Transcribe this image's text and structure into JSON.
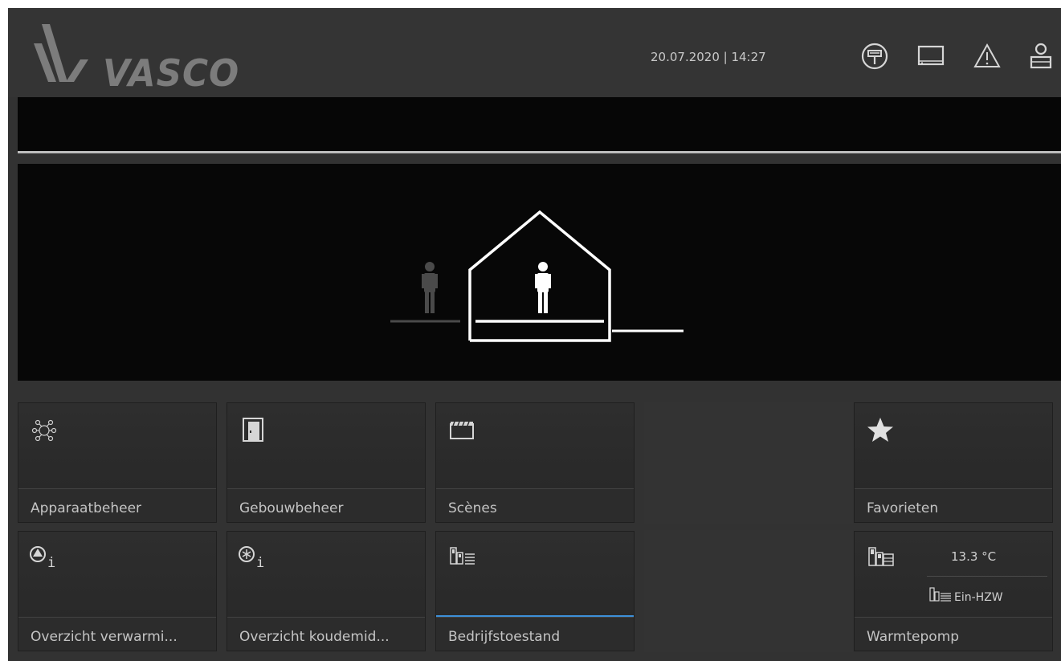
{
  "header": {
    "brand": "VASCO",
    "datetime": "20.07.2020 | 14:27",
    "icons": [
      "thermostat-icon",
      "display-icon",
      "warning-icon",
      "user-icon"
    ]
  },
  "visualization": {
    "scene": "presence-house",
    "icons": [
      "person-away-icon",
      "house-icon",
      "person-home-icon"
    ]
  },
  "tiles": [
    {
      "label": "Apparaatbeheer",
      "icon": "device-network-icon"
    },
    {
      "label": "Gebouwbeheer",
      "icon": "door-icon"
    },
    {
      "label": "Scènes",
      "icon": "clapperboard-icon"
    },
    {
      "label": "Favorieten",
      "icon": "star-icon"
    },
    {
      "label": "Overzicht verwarmi...",
      "icon": "heating-info-icon"
    },
    {
      "label": "Overzicht koudemid...",
      "icon": "cooling-info-icon"
    },
    {
      "label": "Bedrijfstoestand",
      "icon": "heatpump-icon",
      "active": true
    },
    {
      "label": "Warmtepomp",
      "icon": "heatpump-icon",
      "temperature": "13.3 °C",
      "mode": "Ein-HZW"
    }
  ],
  "colors": {
    "background": "#323232",
    "panel": "#070707",
    "accent": "#3d8fd8",
    "text": "#c4c4c4",
    "logo": "#7c7c7c"
  }
}
